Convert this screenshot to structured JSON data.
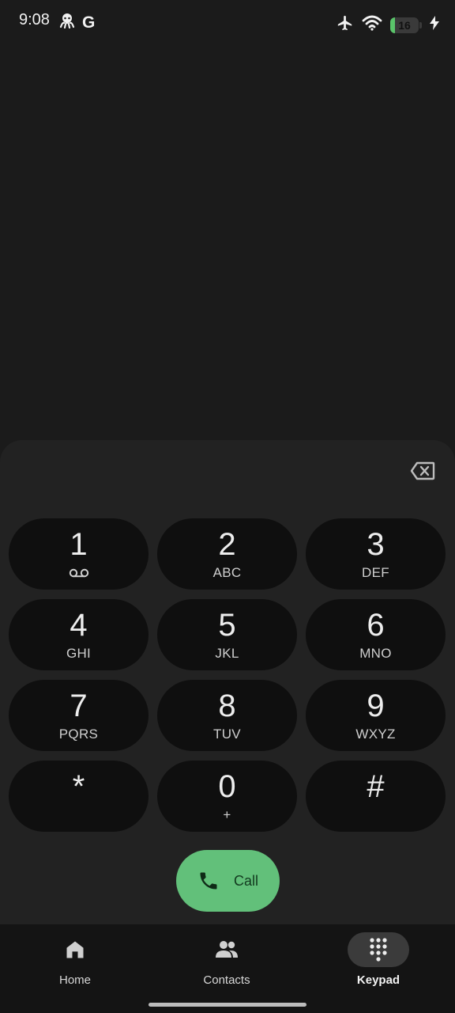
{
  "status_bar": {
    "time": "9:08",
    "g_letter": "G",
    "battery_level": "16",
    "battery_fraction": 0.16,
    "icons": [
      "octopus-icon",
      "google-g-icon",
      "airplane-icon",
      "wifi-icon",
      "battery-icon",
      "charging-bolt-icon"
    ]
  },
  "dialpad": {
    "backspace_icon": "backspace-icon",
    "keys": [
      {
        "digit": "1",
        "letters": "",
        "sub_icon": "voicemail-icon"
      },
      {
        "digit": "2",
        "letters": "ABC"
      },
      {
        "digit": "3",
        "letters": "DEF"
      },
      {
        "digit": "4",
        "letters": "GHI"
      },
      {
        "digit": "5",
        "letters": "JKL"
      },
      {
        "digit": "6",
        "letters": "MNO"
      },
      {
        "digit": "7",
        "letters": "PQRS"
      },
      {
        "digit": "8",
        "letters": "TUV"
      },
      {
        "digit": "9",
        "letters": "WXYZ"
      },
      {
        "digit": "*",
        "letters": ""
      },
      {
        "digit": "0",
        "letters": "+"
      },
      {
        "digit": "#",
        "letters": ""
      }
    ],
    "call_label": "Call",
    "call_color": "#62c07a"
  },
  "bottom_nav": {
    "items": [
      {
        "label": "Home",
        "icon": "home-icon",
        "active": false
      },
      {
        "label": "Contacts",
        "icon": "contacts-icon",
        "active": false
      },
      {
        "label": "Keypad",
        "icon": "dialpad-icon",
        "active": true
      }
    ]
  }
}
